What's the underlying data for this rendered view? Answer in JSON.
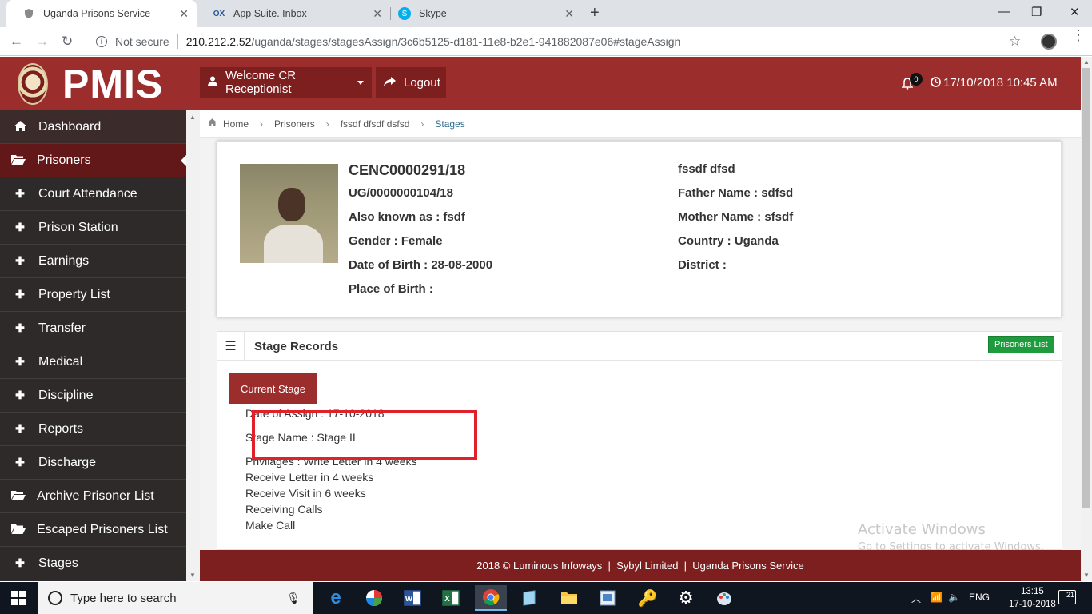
{
  "browser": {
    "tabs": [
      {
        "title": "Uganda Prisons Service",
        "icon": "shield-icon"
      },
      {
        "title": "App Suite. Inbox",
        "icon": "ox-icon",
        "icon_text": "OX"
      },
      {
        "title": "Skype",
        "icon": "skype-icon",
        "icon_text": "S"
      }
    ],
    "new_tab": "+",
    "window_controls": {
      "minimize": "—",
      "maximize": "❐",
      "close": "✕"
    },
    "not_secure": "Not secure",
    "url_host": "210.212.2.52",
    "url_path": "/uganda/stages/stagesAssign/3c6b5125-d181-11e8-b2e1-941882087e06#stageAssign"
  },
  "header": {
    "logo_text": "PMIS",
    "welcome": "Welcome CR Receptionist",
    "logout": "Logout",
    "notifications": "0",
    "datetime": "17/10/2018 10:45 AM"
  },
  "sidebar": {
    "items": [
      {
        "label": "Dashboard",
        "icon": "dashboard-icon"
      },
      {
        "label": "Prisoners",
        "icon": "folder-icon"
      },
      {
        "label": "Court Attendance",
        "icon": "plus-icon"
      },
      {
        "label": "Prison Station",
        "icon": "plus-icon"
      },
      {
        "label": "Earnings",
        "icon": "plus-icon"
      },
      {
        "label": "Property List",
        "icon": "plus-icon"
      },
      {
        "label": "Transfer",
        "icon": "plus-icon"
      },
      {
        "label": "Medical",
        "icon": "plus-icon"
      },
      {
        "label": "Discipline",
        "icon": "plus-icon"
      },
      {
        "label": "Reports",
        "icon": "plus-icon"
      },
      {
        "label": "Discharge",
        "icon": "plus-icon"
      },
      {
        "label": "Archive Prisoner List",
        "icon": "folder-icon"
      },
      {
        "label": "Escaped Prisoners List",
        "icon": "folder-icon"
      },
      {
        "label": "Stages",
        "icon": "plus-icon"
      }
    ]
  },
  "breadcrumb": [
    "Home",
    "Prisoners",
    "fssdf dfsdf dsfsd",
    "Stages"
  ],
  "profile": {
    "number": "CENC0000291/18",
    "ug_number": "UG/0000000104/18",
    "aka": "Also known as : fsdf",
    "gender": "Gender : Female",
    "dob": "Date of Birth : 28-08-2000",
    "pob": "Place of Birth :",
    "name": "fssdf dfsd",
    "father": "Father Name : sdfsd",
    "mother": "Mother Name : sfsdf",
    "country": "Country : Uganda",
    "district": "District :"
  },
  "stage": {
    "title": "Stage Records",
    "prisoners_list_btn": "Prisoners List",
    "current_stage_btn": "Current Stage",
    "date_of_assign": "Date of Assign : 17-10-2018",
    "stage_name": "Stage Name : Stage II",
    "privileges": [
      "Privilages : Write Letter in 4 weeks",
      "Receive Letter in 4 weeks",
      "Receive Visit in 6 weeks",
      "Receiving Calls",
      "Make Call"
    ]
  },
  "watermark": {
    "line1": "Activate Windows",
    "line2": "Go to Settings to activate Windows."
  },
  "footer": {
    "year": "2018 ©",
    "company1": "Luminous Infoways",
    "company2": "Sybyl Limited",
    "company3": "Uganda Prisons Service"
  },
  "taskbar": {
    "search_placeholder": "Type here to search",
    "language": "ENG",
    "time": "13:15",
    "date": "17-10-2018",
    "notif_count": "21"
  }
}
